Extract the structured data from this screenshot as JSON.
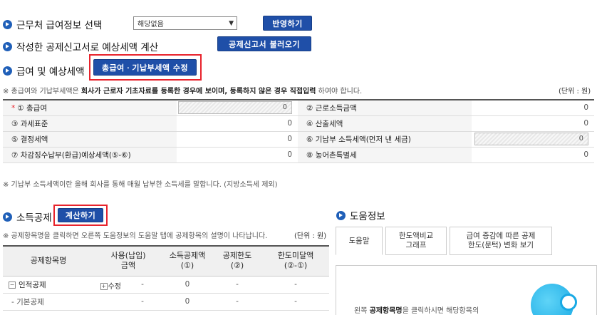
{
  "sections": {
    "workplace": "근무처 급여정보 선택",
    "workplace_select": "해당없음",
    "apply_button": "반영하기",
    "calc_from_form": "작성한 공제신고서로 예상세액 계산",
    "load_form_button": "공제신고서 불러오기",
    "salary_estimate": "급여 및 예상세액",
    "edit_salary_button": "총급여ㆍ기납부세액 수정"
  },
  "notes": {
    "salary_note_pre": "※ 총급여와 기납부세액은 ",
    "salary_note_bold": "회사가 근로자 기초자료를 등록한 경우에 보이며, 등록하지 않은 경우 직접입력",
    "salary_note_post": " 하여야 합니다.",
    "unit": "(단위 : 원)",
    "prepaid_note": "※ 기납부 소득세액이란 올해 회사를 통해 매월 납부한 소득세를 말합니다. (지방소득세 제외)",
    "deduction_note": "※ 공제항목명을 클릭하면 오른쪽 도움정보의 도움말 탭에 공제항목의 설명이 나타납니다.",
    "unit2": "(단위 : 원)"
  },
  "salary_table": {
    "rows": [
      {
        "l1": "① 총급여",
        "v1": "0",
        "l2": "② 근로소득금액",
        "v2": "0"
      },
      {
        "l1": "③ 과세표준",
        "v1": "0",
        "l2": "④ 산출세액",
        "v2": "0"
      },
      {
        "l1": "⑤ 결정세액",
        "v1": "0",
        "l2": "⑥ 기납부 소득세액(먼저 낸 세금)",
        "v2": "0"
      },
      {
        "l1": "⑦ 차감징수납부(환급)예상세액(⑤-⑥)",
        "v1": "0",
        "l2": "⑧ 농어촌특별세",
        "v2": "0"
      }
    ],
    "required_mark": "*"
  },
  "deduction": {
    "title": "소득공제",
    "calc_button": "계산하기",
    "headers": [
      "공제항목명",
      "사용(납입)\n금액",
      "소득공제액\n(①)",
      "공제한도\n(②)",
      "한도미달액\n(②-①)"
    ],
    "rows": [
      {
        "name": "인적공제",
        "action": "수정",
        "used": "-",
        "ded": "0",
        "limit": "-",
        "short": "-"
      },
      {
        "name": "- 기본공제",
        "action": "",
        "used": "-",
        "ded": "0",
        "limit": "-",
        "short": "-"
      }
    ]
  },
  "help": {
    "title": "도움정보",
    "tabs": [
      "도움말",
      "한도액비교\n그래프",
      "급여 증감에 따른 공제\n한도(문턱) 변화 보기"
    ],
    "text_bold": "공제항목명",
    "text_pre": "왼쪽 ",
    "text_post": "을 클릭하시면 해당항목의"
  },
  "colors": {
    "accent": "#1f4fa8",
    "highlight": "#e8232c"
  }
}
